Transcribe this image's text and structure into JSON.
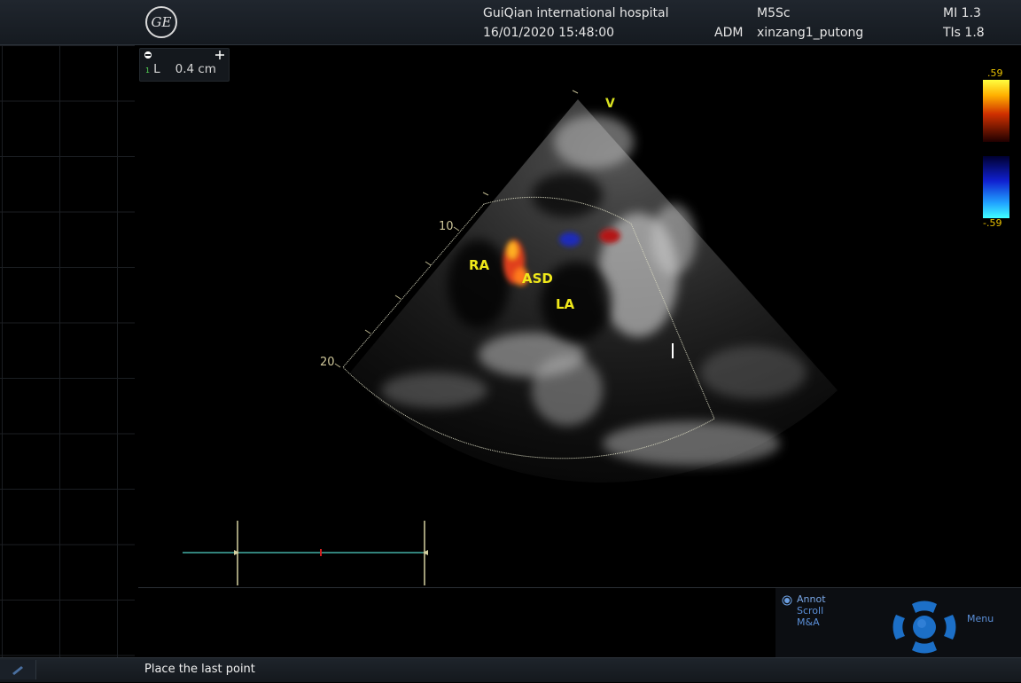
{
  "header": {
    "logo_text": "GE",
    "hospital": "GuiQian international hospital",
    "datetime": "16/01/2020 15:48:00",
    "probe": "M5Sc",
    "operator": "ADM",
    "preset": "xinzang1_putong",
    "mi": "MI 1.3",
    "tis": "TIs 1.8"
  },
  "measurement": {
    "index": "1",
    "label": "L",
    "value": "0.4 cm"
  },
  "color_scale": {
    "top": ".59",
    "bottom": "-.59"
  },
  "image_labels": {
    "ra": "RA",
    "asd": "ASD",
    "la": "LA",
    "v_marker": "V",
    "depth_10": "10",
    "depth_20": "20"
  },
  "control_panel": {
    "items": [
      "Annot",
      "Scroll",
      "M&A"
    ],
    "selected": "Annot",
    "menu": "Menu"
  },
  "status_bar": {
    "message": "Place the last point"
  },
  "colors": {
    "label_yellow": "#f0e81a",
    "caliper_line": "#4fd1c5",
    "accent_blue": "#1c6fc7"
  }
}
